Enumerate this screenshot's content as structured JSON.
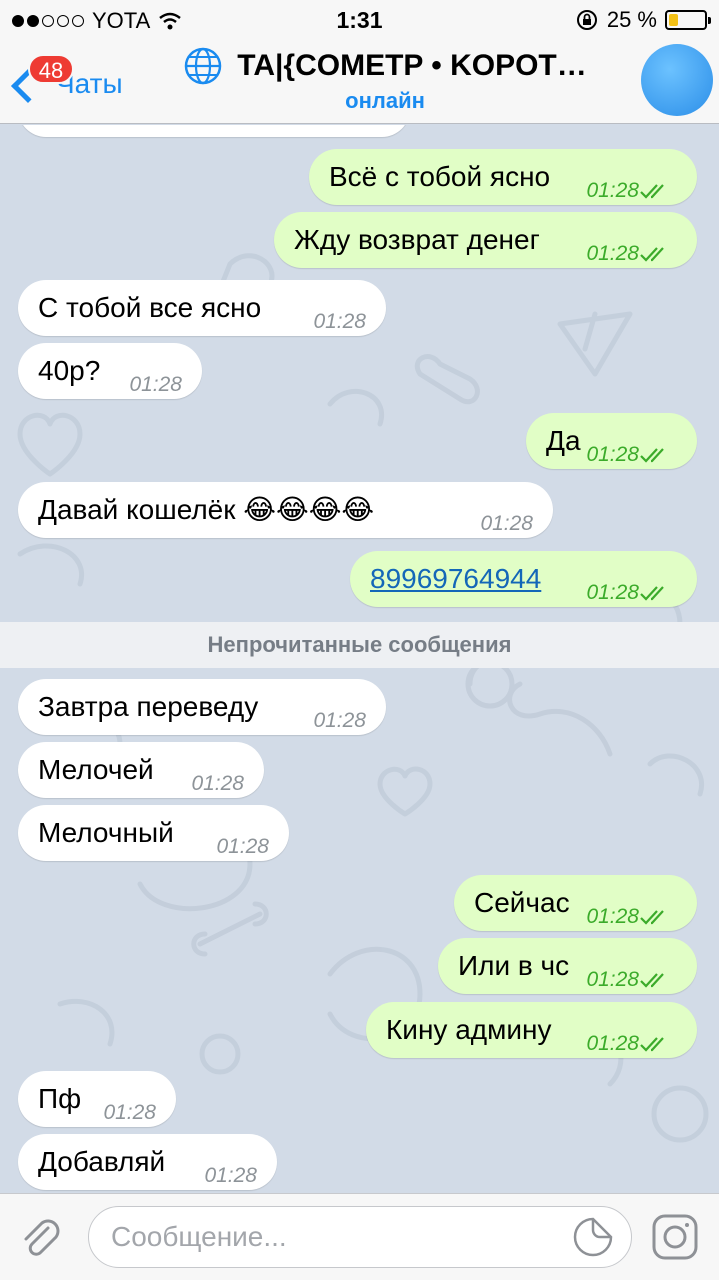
{
  "status_bar": {
    "carrier": "YOTA",
    "time": "1:31",
    "battery_percent": "25 %",
    "battery_level": 0.25,
    "signal_bars": 2
  },
  "header": {
    "back_label": "Чаты",
    "unread_count": "48",
    "title": "TA|{COMETP • KOPOT…",
    "status": "онлайн",
    "accent_color": "#1a8bf0"
  },
  "messages_before": [
    {
      "dir": "out",
      "text": "Всё с тобой ясно",
      "time": "01:28"
    },
    {
      "dir": "out",
      "text": "Жду возврат денег",
      "time": "01:28"
    },
    {
      "dir": "in",
      "text": "С тобой все ясно",
      "time": "01:28"
    },
    {
      "dir": "in",
      "text": "40р?",
      "time": "01:28"
    },
    {
      "dir": "out",
      "text": "Да",
      "time": "01:28"
    },
    {
      "dir": "in",
      "text": "Давай  кошелёк 😂😂😂😂",
      "time": "01:28"
    },
    {
      "dir": "out",
      "text": "89969764944",
      "time": "01:28",
      "link": true
    }
  ],
  "unread_divider": "Непрочитанные сообщения",
  "messages_after": [
    {
      "dir": "in",
      "text": "Завтра переведу",
      "time": "01:28"
    },
    {
      "dir": "in",
      "text": "Мелочей",
      "time": "01:28"
    },
    {
      "dir": "in",
      "text": "Мелочный",
      "time": "01:28"
    },
    {
      "dir": "out",
      "text": "Сейчас",
      "time": "01:28"
    },
    {
      "dir": "out",
      "text": "Или в чс",
      "time": "01:28"
    },
    {
      "dir": "out",
      "text": "Кину админу",
      "time": "01:28"
    },
    {
      "dir": "in",
      "text": "Пф",
      "time": "01:28"
    },
    {
      "dir": "in",
      "text": "Добавляй",
      "time": "01:28"
    }
  ],
  "input": {
    "placeholder": "Сообщение...",
    "value": ""
  },
  "icons": {
    "attach": "paperclip-icon",
    "sticker": "sticker-icon",
    "camera": "camera-icon",
    "read_receipt": "double-check-icon",
    "globe": "globe-icon"
  }
}
